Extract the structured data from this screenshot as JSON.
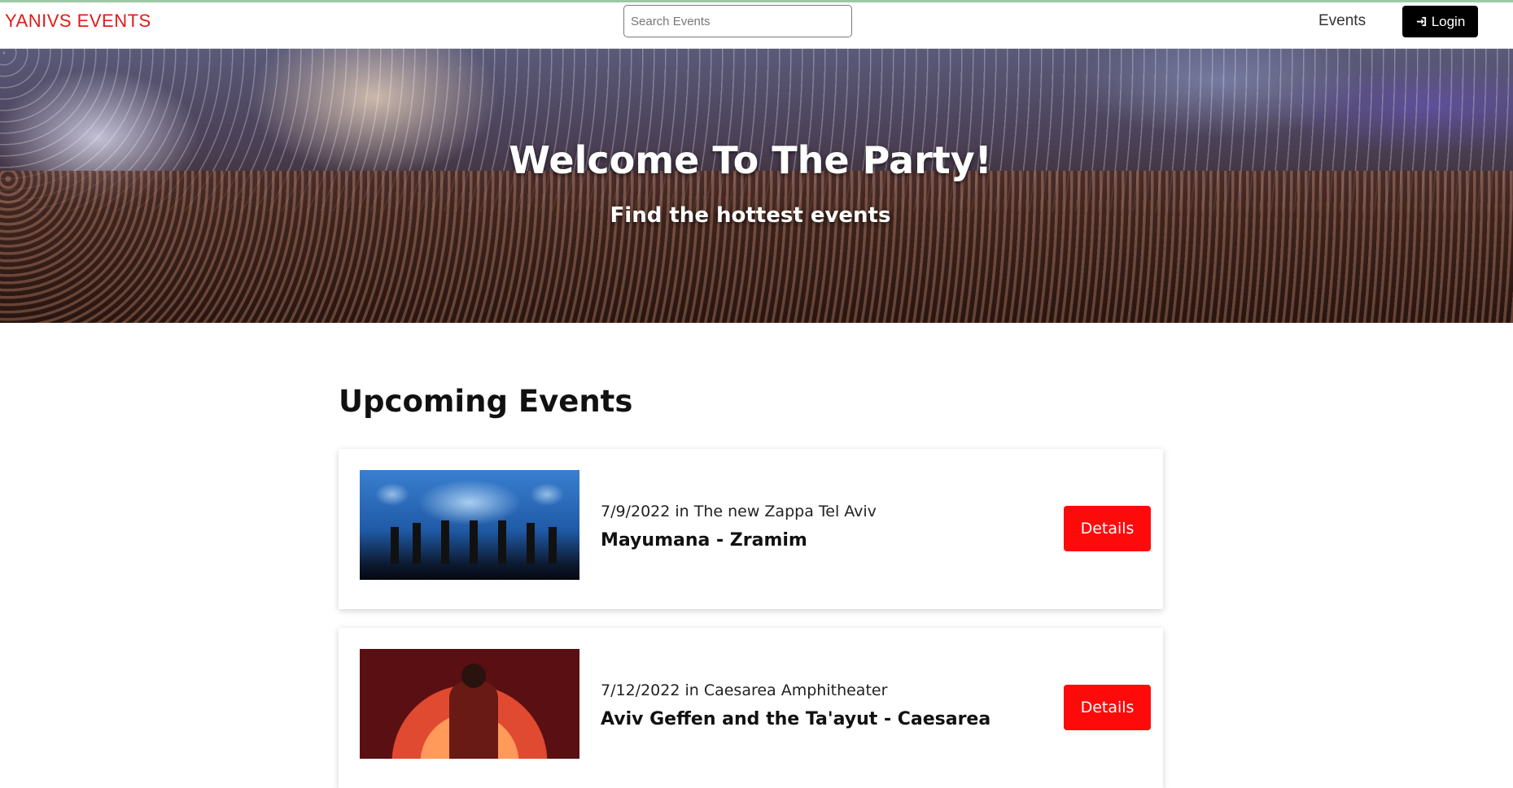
{
  "header": {
    "brand": "YANIVS EVENTS",
    "search_placeholder": "Search Events",
    "nav_events": "Events",
    "login_label": "Login",
    "login_icon": "sign-in-icon"
  },
  "hero": {
    "title": "Welcome To The Party!",
    "subtitle": "Find the hottest events"
  },
  "upcoming": {
    "title": "Upcoming Events",
    "events": [
      {
        "meta": "7/9/2022 in The new Zappa Tel Aviv",
        "name": "Mayumana - Zramim",
        "button": "Details"
      },
      {
        "meta": "7/12/2022 in Caesarea Amphitheater",
        "name": "Aviv Geffen and the Ta'ayut - Caesarea",
        "button": "Details"
      }
    ]
  },
  "colors": {
    "brand": "#e01b1b",
    "details_button": "#ff0a0a",
    "login_button": "#000000"
  }
}
